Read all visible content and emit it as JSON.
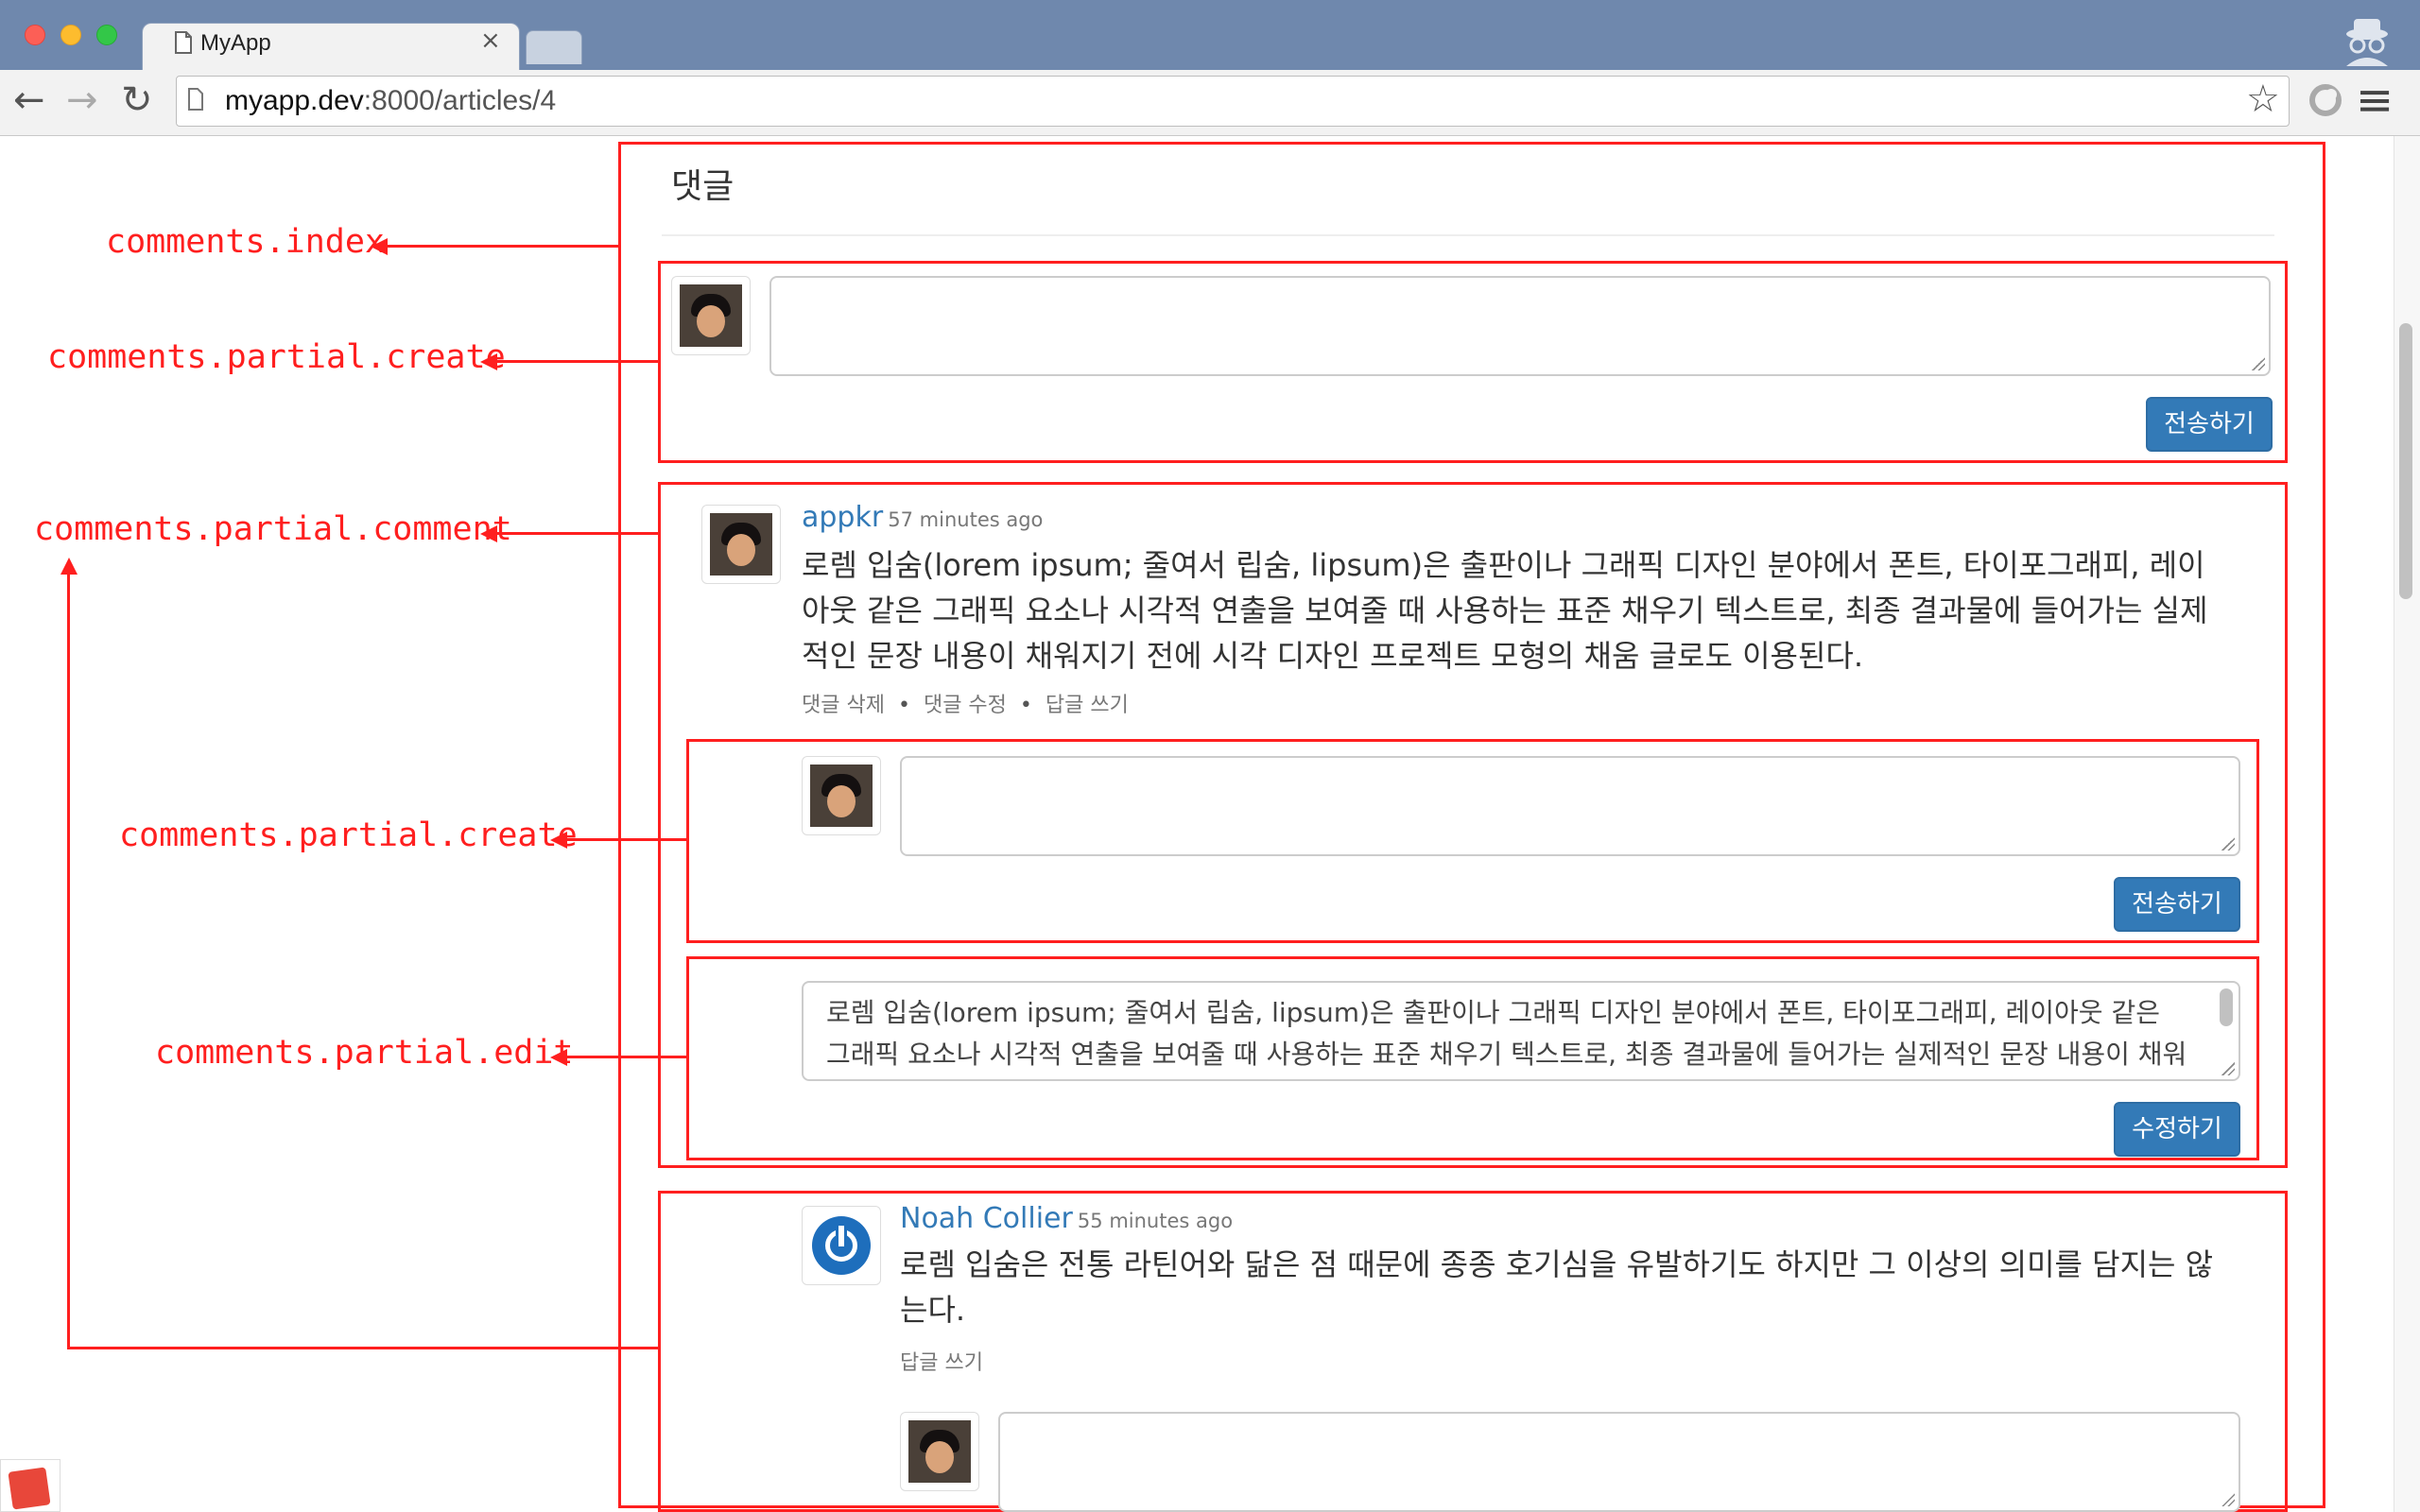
{
  "browser": {
    "tab_title": "MyApp",
    "tab_close": "×",
    "url_host": "myapp.dev",
    "url_path": ":8000/articles/4",
    "back_icon": "arrow-left-icon",
    "forward_icon": "arrow-right-icon",
    "reload_icon": "reload-icon",
    "back_glyph": "←",
    "forward_glyph": "→",
    "reload_glyph": "↻",
    "star_glyph": "☆",
    "menu_glyph": "≡"
  },
  "comments": {
    "heading": "댓글",
    "create_submit": "전송하기",
    "items": [
      {
        "author": "appkr",
        "time_ago": "57 minutes ago",
        "body": "로렘 입숨(lorem ipsum; 줄여서 립숨, lipsum)은 출판이나 그래픽 디자인 분야에서 폰트, 타이포그래피, 레이아웃 같은 그래픽 요소나 시각적 연출을 보여줄 때 사용하는 표준 채우기 텍스트로, 최종 결과물에 들어가는 실제적인 문장 내용이 채워지기 전에 시각 디자인 프로젝트 모형의 채움 글로도 이용된다.",
        "actions": [
          "댓글 삭제",
          "댓글 수정",
          "답글 쓰기"
        ],
        "reply_submit": "전송하기",
        "edit_value": "로렘 입숨(lorem ipsum; 줄여서 립숨, lipsum)은 출판이나 그래픽 디자인 분야에서 폰트, 타이포그래피, 레이아웃 같은 그래픽 요소나 시각적 연출을 보여줄 때 사용하는 표준 채우기 텍스트로, 최종 결과물에 들어가는 실제적인 문장 내용이 채워지기 전에 시각 디자인 프로젝트 모형의 채움 글로도 이용된다.",
        "edit_submit": "수정하기"
      },
      {
        "author": "Noah Collier",
        "time_ago": "55 minutes ago",
        "body": "로렘 입숨은 전통 라틴어와 닮은 점 때문에 종종 호기심을 유발하기도 하지만 그 이상의 의미를 담지는 않는다.",
        "actions": [
          "답글 쓰기"
        ]
      }
    ]
  },
  "annotations": {
    "index": "comments.index",
    "create_top": "comments.partial.create",
    "comment": "comments.partial.comment",
    "create_nested": "comments.partial.create",
    "edit": "comments.partial.edit"
  },
  "colors": {
    "annotation": "#ff1f1f",
    "primary_button": "#337ab7",
    "link": "#337ab7",
    "titlebar": "#6f88ad"
  }
}
